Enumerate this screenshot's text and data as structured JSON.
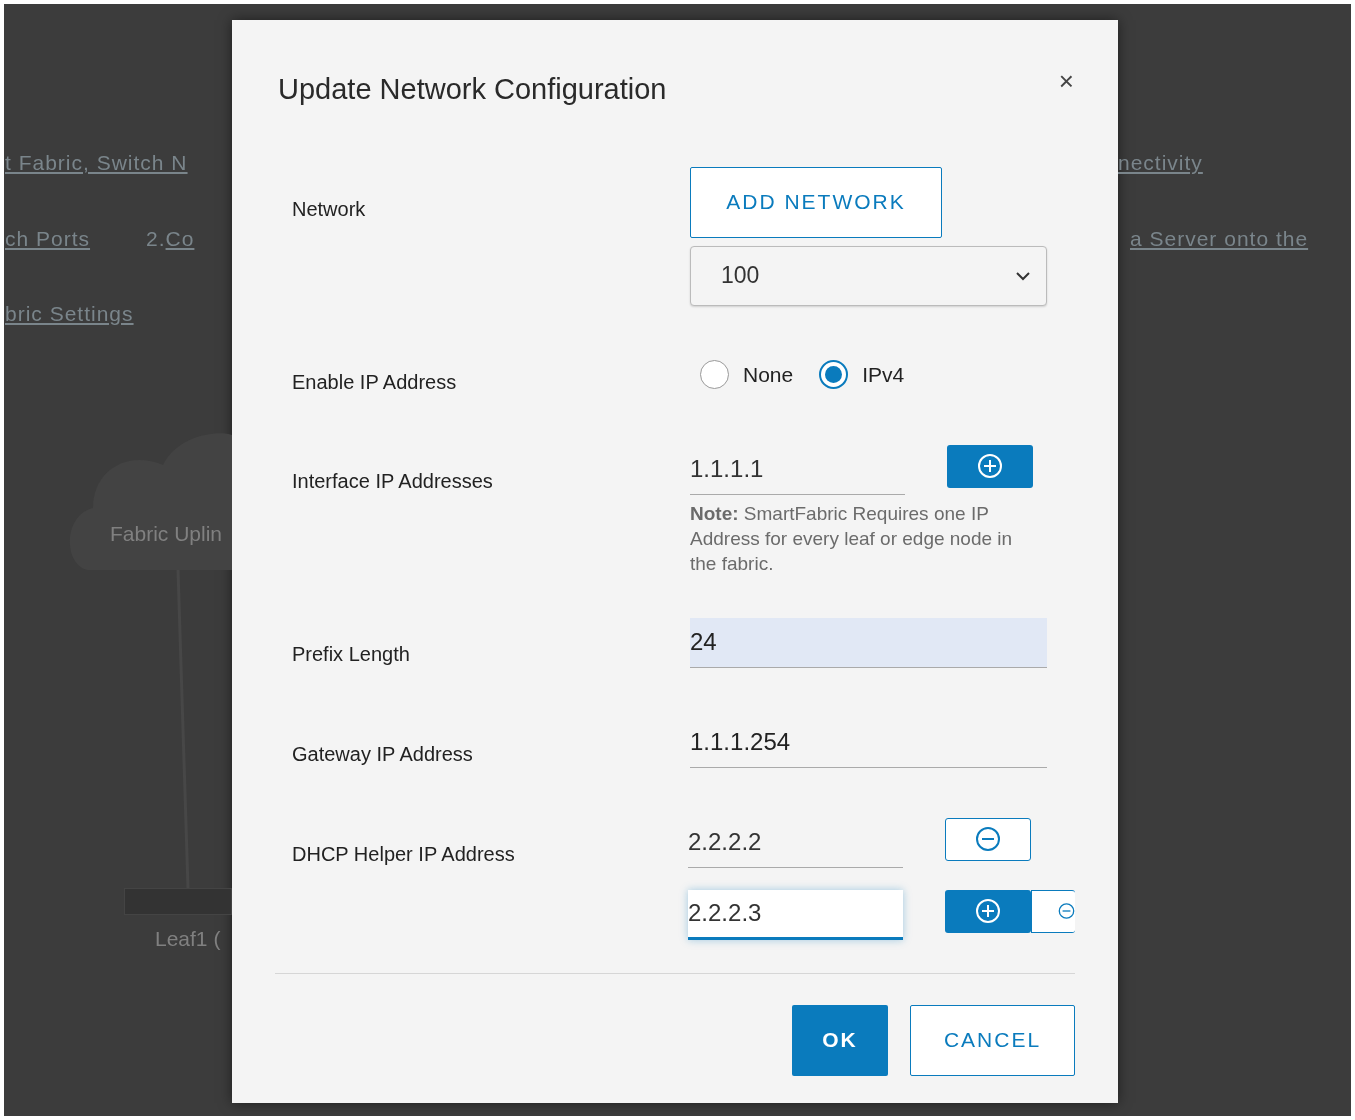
{
  "background": {
    "links_left": [
      "t Fabric, Switch N",
      "ch Ports",
      "bric Settings"
    ],
    "step_number": "2.",
    "step_link": "Co",
    "links_right": [
      "nectivity",
      "a Server onto the"
    ],
    "cloud_label": "Fabric Uplin",
    "switch_label": "Leaf1 ("
  },
  "dialog": {
    "title": "Update Network Configuration",
    "close": "×",
    "fields": [
      {
        "kind": "network",
        "label": "Network",
        "add_button": "ADD NETWORK",
        "value": "100"
      },
      {
        "kind": "radio",
        "label": "Enable IP Address",
        "options": [
          {
            "label": "None",
            "selected": false
          },
          {
            "label": "IPv4",
            "selected": true
          }
        ]
      },
      {
        "kind": "list",
        "label": "Interface IP Addresses",
        "entries": [
          {
            "value": "1.1.1.1",
            "focused": false,
            "add": true,
            "remove": false
          }
        ],
        "note": "**Note:** SmartFabric Requires one IP Address for every leaf or edge node in the fabric."
      },
      {
        "kind": "text",
        "label": "Prefix Length",
        "value": "24",
        "autofilled": true
      },
      {
        "kind": "text",
        "label": "Gateway IP Address",
        "value": "1.1.1.254",
        "autofilled": false
      },
      {
        "kind": "list",
        "label": "DHCP Helper IP Address",
        "entries": [
          {
            "value": "2.2.2.2",
            "focused": false,
            "add": false,
            "remove": true
          },
          {
            "value": "2.2.2.3",
            "focused": true,
            "add": true,
            "remove": true
          }
        ]
      }
    ],
    "buttons": [
      {
        "label": "OK",
        "primary": true
      },
      {
        "label": "CANCEL",
        "primary": false
      }
    ]
  }
}
